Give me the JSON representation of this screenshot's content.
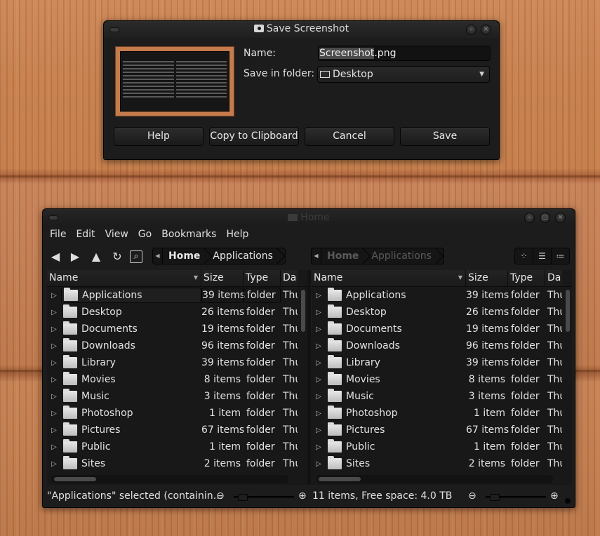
{
  "dialog": {
    "title": "Save Screenshot",
    "name_label": "Name:",
    "name_value_selected": "Screenshot",
    "name_value_ext": ".png",
    "folder_label": "Save in folder:",
    "folder_value": "Desktop",
    "buttons": {
      "help": "Help",
      "copy": "Copy to Clipboard",
      "cancel": "Cancel",
      "save": "Save"
    }
  },
  "window": {
    "title": "Home",
    "menu": [
      "File",
      "Edit",
      "View",
      "Go",
      "Bookmarks",
      "Help"
    ]
  },
  "left_pane": {
    "path": [
      "Home",
      "Applications"
    ],
    "columns": {
      "name": "Name",
      "size": "Size",
      "type": "Type",
      "date": "Da"
    }
  },
  "right_pane": {
    "path": [
      "Home",
      "Applications"
    ],
    "columns": {
      "name": "Name",
      "size": "Size",
      "type": "Type",
      "date": "Da"
    }
  },
  "rows": [
    {
      "name": "Applications",
      "size": "39 items",
      "type": "folder",
      "date": "Thu"
    },
    {
      "name": "Desktop",
      "size": "26 items",
      "type": "folder",
      "date": "Thu"
    },
    {
      "name": "Documents",
      "size": "19 items",
      "type": "folder",
      "date": "Thu"
    },
    {
      "name": "Downloads",
      "size": "96 items",
      "type": "folder",
      "date": "Thu"
    },
    {
      "name": "Library",
      "size": "39 items",
      "type": "folder",
      "date": "Thu"
    },
    {
      "name": "Movies",
      "size": "8 items",
      "type": "folder",
      "date": "Thu"
    },
    {
      "name": "Music",
      "size": "3 items",
      "type": "folder",
      "date": "Thu"
    },
    {
      "name": "Photoshop",
      "size": "1 item",
      "type": "folder",
      "date": "Thu"
    },
    {
      "name": "Pictures",
      "size": "67 items",
      "type": "folder",
      "date": "Thu"
    },
    {
      "name": "Public",
      "size": "1 item",
      "type": "folder",
      "date": "Thu"
    },
    {
      "name": "Sites",
      "size": "2 items",
      "type": "folder",
      "date": "Thu"
    }
  ],
  "status": {
    "left": "\"Applications\" selected (containin…",
    "right": "11 items, Free space: 4.0 TB"
  },
  "icons": {
    "back": "◀",
    "forward": "▶",
    "up": "▲",
    "reload": "↻",
    "search": "⌕",
    "zoom_out": "⊖",
    "zoom_in": "⊕",
    "expander": "▷"
  }
}
